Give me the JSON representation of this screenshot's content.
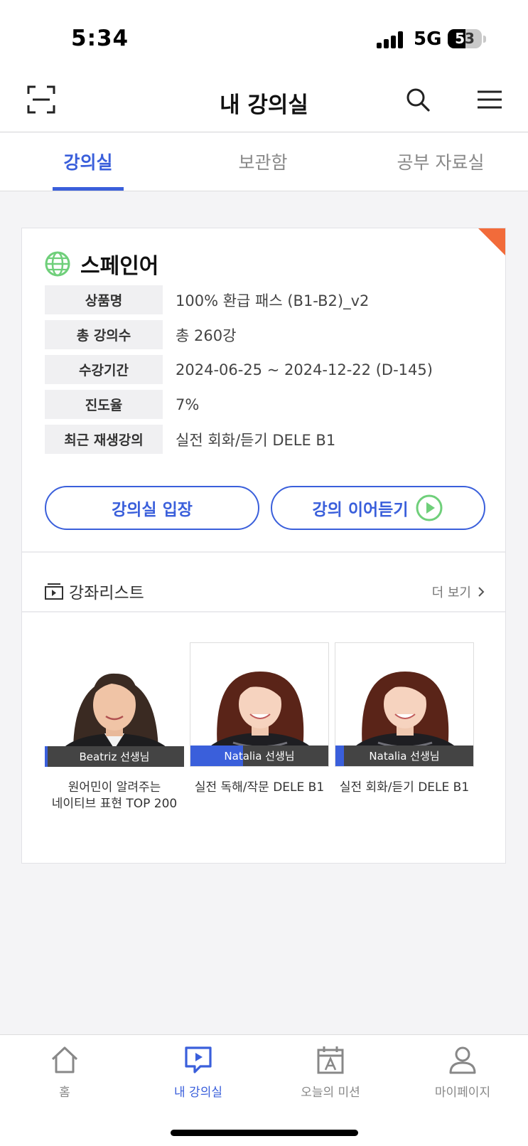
{
  "status_bar": {
    "time": "5:34",
    "network": "5G",
    "battery_level": "53",
    "battery_percent": 53
  },
  "header": {
    "title": "내 강의실"
  },
  "tabs": [
    {
      "label": "강의실",
      "active": true
    },
    {
      "label": "보관함",
      "active": false
    },
    {
      "label": "공부 자료실",
      "active": false
    }
  ],
  "course_card": {
    "language": "스페인어",
    "info": [
      {
        "label": "상품명",
        "value": "100% 환급 패스 (B1-B2)_v2"
      },
      {
        "label": "총 강의수",
        "value": "총 260강"
      },
      {
        "label": "수강기간",
        "value": "2024-06-25 ~ 2024-12-22 (D-145)"
      },
      {
        "label": "진도율",
        "value": "7%"
      },
      {
        "label": "최근 재생강의",
        "value": "실전 회화/듣기 DELE B1"
      }
    ],
    "enter_button": "강의실 입장",
    "continue_button": "강의 이어듣기"
  },
  "course_list": {
    "title": "강좌리스트",
    "more": "더 보기",
    "items": [
      {
        "teacher": "Beatriz 선생님",
        "title_line1": "원어민이 알려주는",
        "title_line2": "네이티브 표현 TOP 200",
        "progress": 0.02
      },
      {
        "teacher": "Natalia 선생님",
        "title_line1": "실전 독해/작문 DELE B1",
        "title_line2": "",
        "progress": 0.38
      },
      {
        "teacher": "Natalia 선생님",
        "title_line1": "실전 회화/듣기 DELE B1",
        "title_line2": "",
        "progress": 0.06
      }
    ]
  },
  "bottom_nav": [
    {
      "label": "홈",
      "icon": "home-icon",
      "active": false
    },
    {
      "label": "내 강의실",
      "icon": "lecture-chat-icon",
      "active": true
    },
    {
      "label": "오늘의 미션",
      "icon": "calendar-a-icon",
      "active": false
    },
    {
      "label": "마이페이지",
      "icon": "person-icon",
      "active": false
    }
  ],
  "colors": {
    "accent": "#3a5fdb",
    "corner": "#f26b3a",
    "play_green": "#6fcf7a"
  }
}
